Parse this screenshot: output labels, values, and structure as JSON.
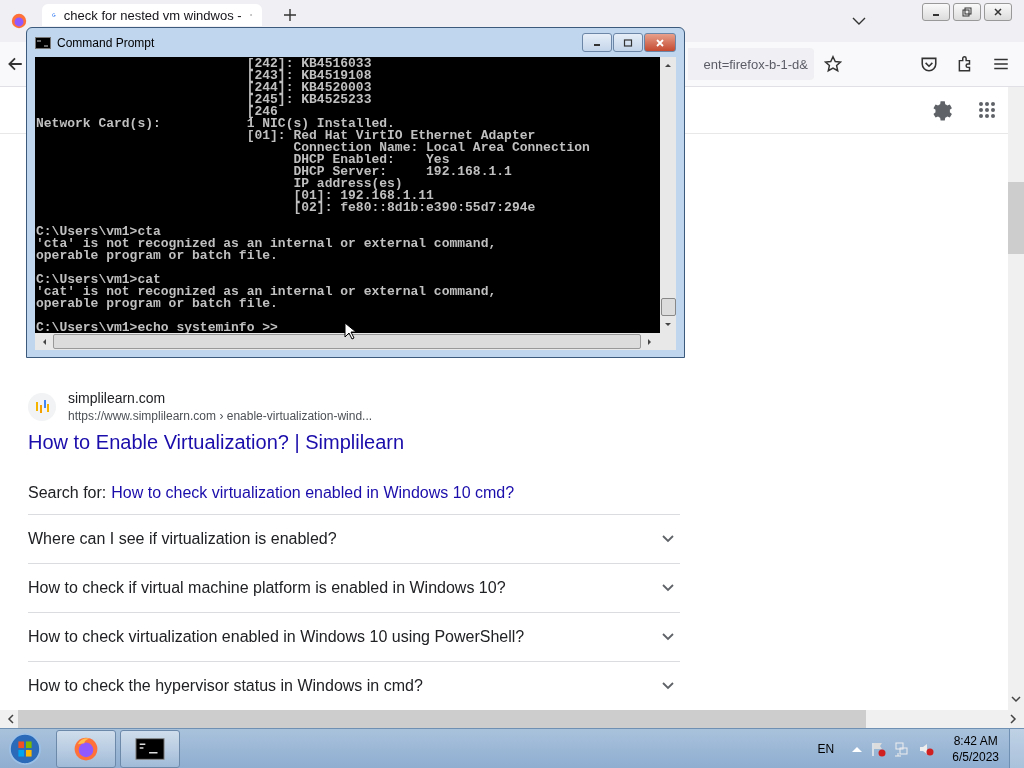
{
  "browser": {
    "tab": {
      "title": "check for nested vm windwos -"
    },
    "url_fragment": "ent=firefox-b-1-d&"
  },
  "cmd_window": {
    "title": "Command Prompt",
    "blocks": [
      [
        "                           [242]: KB4516033",
        "                           [243]: KB4519108",
        "                           [244]: KB4520003",
        "                           [245]: KB4525233",
        "                           [246",
        "Network Card(s):           1 NIC(s) Installed.",
        "                           [01]: Red Hat VirtIO Ethernet Adapter",
        "                                 Connection Name: Local Area Connection",
        "                                 DHCP Enabled:    Yes",
        "                                 DHCP Server:     192.168.1.1",
        "                                 IP address(es)",
        "                                 [01]: 192.168.1.11",
        "                                 [02]: fe80::8d1b:e390:55d7:294e"
      ],
      [
        "C:\\Users\\vm1>cta",
        "'cta' is not recognized as an internal or external command,",
        "operable program or batch file."
      ],
      [
        "C:\\Users\\vm1>cat",
        "'cat' is not recognized as an internal or external command,",
        "operable program or batch file."
      ],
      [
        "C:\\Users\\vm1>echo systeminfo >>"
      ]
    ]
  },
  "result": {
    "site": "simplilearn.com",
    "url": "https://www.simplilearn.com › enable-virtualization-wind...",
    "title": "How to Enable Virtualization? | Simplilearn"
  },
  "search_for": {
    "label": "Search for:",
    "link": "How to check virtualization enabled in Windows 10 cmd?"
  },
  "questions": [
    {
      "text": "Where can I see if virtualization is enabled?",
      "expanded": false
    },
    {
      "text": "How to check if virtual machine platform is enabled in Windows 10?",
      "expanded": false
    },
    {
      "text": "How to check virtualization enabled in Windows 10 using PowerShell?",
      "expanded": false
    },
    {
      "text": "How to check the hypervisor status in Windows in cmd?",
      "expanded": false
    }
  ],
  "taskbar": {
    "apps": [
      {
        "kind": "firefox"
      },
      {
        "kind": "cmd"
      }
    ],
    "language": "EN",
    "time": "8:42 AM",
    "date": "6/5/2023"
  }
}
